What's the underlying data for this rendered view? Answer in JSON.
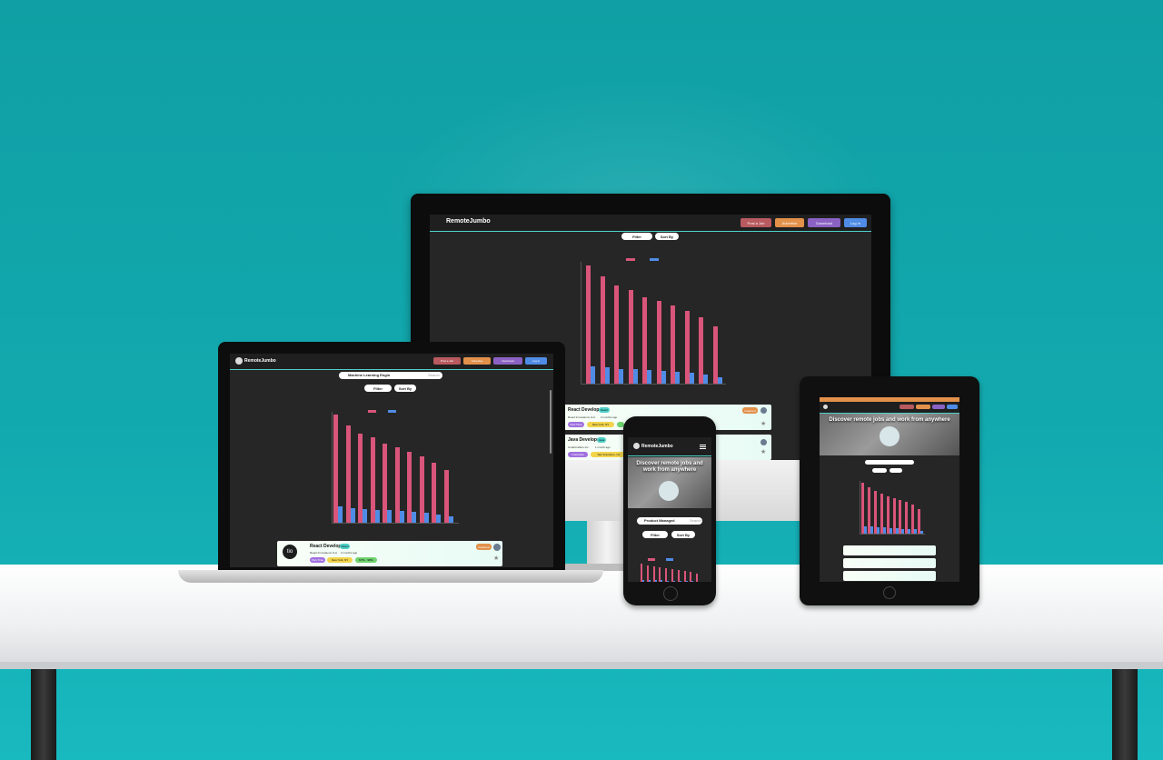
{
  "brand": {
    "name": "RemoteJumbo"
  },
  "nav": {
    "post_job": "Post a Job",
    "advertise": "Advertise",
    "download": "Download",
    "login": "Log In"
  },
  "controls": {
    "filter": "Filter",
    "sort_by": "Sort By",
    "search_laptop": "Machine Learning Engin",
    "search_phone": "Product Managed",
    "search_button": "Search"
  },
  "hero": {
    "headline": "Discover remote jobs and work from anywhere"
  },
  "chart_data": {
    "type": "bar",
    "title": "",
    "series": [
      {
        "name": "",
        "color": "#d9557a",
        "values": [
          175,
          158,
          145,
          138,
          128,
          122,
          115,
          108,
          98,
          85
        ]
      },
      {
        "name": "",
        "color": "#4f8ce6",
        "values": [
          26,
          24,
          22,
          21,
          20,
          19,
          17,
          16,
          14,
          10
        ]
      }
    ],
    "ylim": [
      0,
      180
    ],
    "grid": false,
    "legend": "top-center"
  },
  "jobs": [
    {
      "title": "React Developer",
      "badge": "React",
      "company": "React Innovations LLC",
      "posted": "2 months ago",
      "featured": "Featured",
      "tags": [
        "Part-Time",
        "New York, NY",
        "$75k - $95k"
      ]
    },
    {
      "title": "Java Developer",
      "badge": "Java",
      "company": "CodeCrafters Inc.",
      "posted": "1 month ago",
      "tags": [
        "Internship",
        "San Francisco, CA"
      ]
    }
  ],
  "colors": {
    "background": "#0f9fa4",
    "screen": "#262626",
    "accent": "#4dd0c8",
    "female_bar": "#d9557a",
    "applied_bar": "#4f8ce6"
  }
}
